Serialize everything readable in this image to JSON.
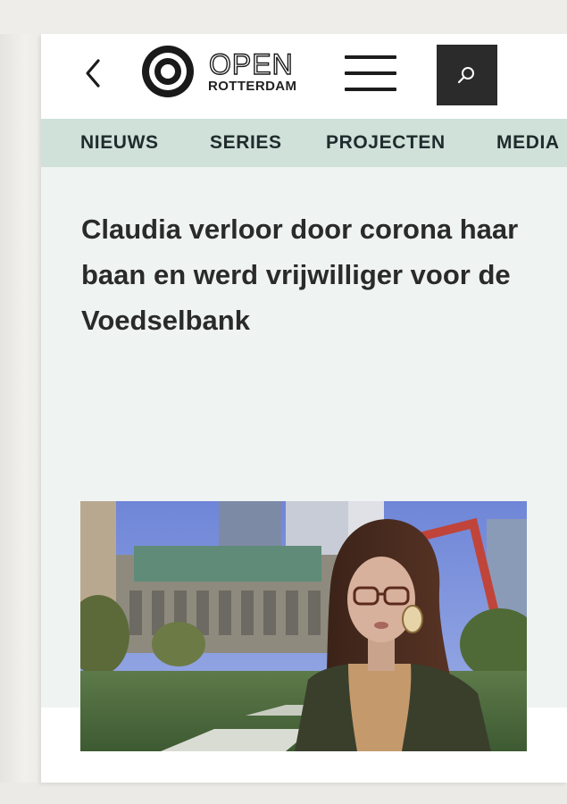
{
  "header": {
    "logo_main": "OPEN",
    "logo_sub": "ROTTERDAM",
    "back_icon": "chevron-left-icon",
    "menu_icon": "hamburger-menu-icon",
    "search_icon": "search-icon"
  },
  "nav": {
    "items": [
      {
        "label": "NIEUWS"
      },
      {
        "label": "SERIES"
      },
      {
        "label": "PROJECTEN"
      },
      {
        "label": "MEDIA"
      }
    ]
  },
  "article": {
    "title": "Claudia verloor door corona haar baan en werd vrijwilliger voor de Voedselbank"
  },
  "colors": {
    "nav_background": "#cfe1d9",
    "content_background": "#eff3f2",
    "search_button": "#2b2b2b",
    "text": "#2a2a2a"
  }
}
